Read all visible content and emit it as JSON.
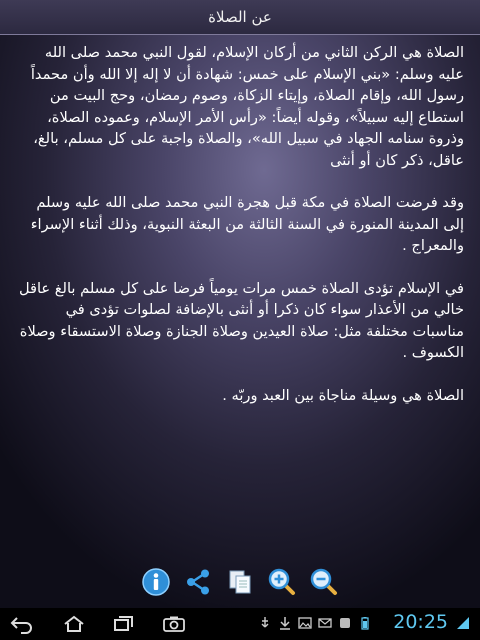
{
  "app": {
    "title": "عن الصلاة"
  },
  "content": {
    "paragraphs": [
      "الصلاة هي الركن الثاني من أركان الإسلام، لقول النبي محمد صلى الله عليه وسلم: «بني الإسلام على خمس: شهادة أن لا إله إلا الله وأن محمداً رسول الله، وإقام الصلاة، وإيتاء الزكاة، وصوم رمضان، وحج البيت من استطاع إليه سبيلاً»، وقوله أيضاً: «رأس الأمر الإسلام، وعموده الصلاة، وذروة سنامه الجهاد في سبيل الله»، والصلاة واجبة على كل مسلم، بالغ، عاقل، ذكر كان أو أنثى",
      "وقد فرضت الصلاة في مكة قبل هجرة النبي محمد صلى الله عليه وسلم إلى المدينة المنورة في السنة الثالثة من البعثة النبوية، وذلك أثناء الإسراء والمعراج .",
      "في الإسلام تؤدى الصلاة خمس مرات يومياً فرضا على كل مسلم بالغ عاقل خالي من الأعذار سواء كان ذكرا أو أنثى بالإضافة لصلوات تؤدى في مناسبات مختلفة مثل: صلاة العيدين وصلاة الجنازة وصلاة الاستسقاء وصلاة الكسوف .",
      "الصلاة هي وسيلة مناجاة بين العبد وربّه ."
    ]
  },
  "toolbar": {
    "icons": [
      "info-icon",
      "share-icon",
      "copy-icon",
      "zoom-in-icon",
      "zoom-out-icon"
    ]
  },
  "navbar": {
    "clock": "20:25"
  },
  "colors": {
    "accent": "#2f8fd8",
    "clock": "#5fc8f0"
  }
}
